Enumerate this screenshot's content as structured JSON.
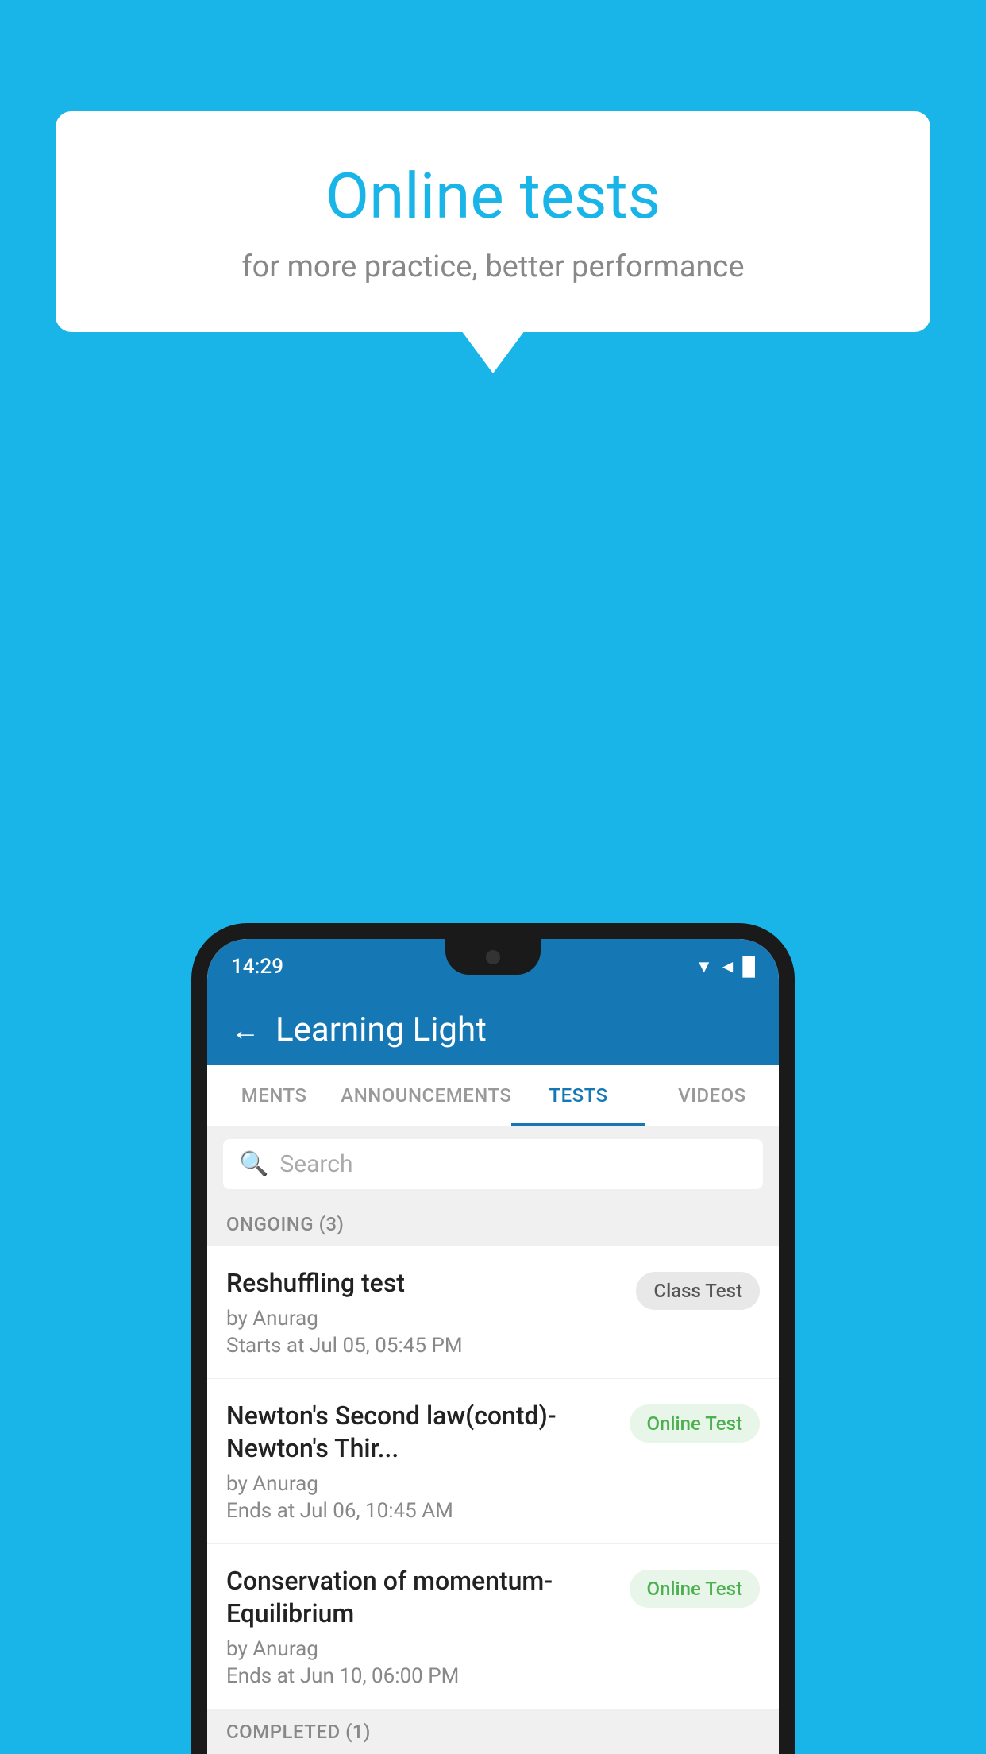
{
  "background": {
    "color": "#1ab5e8"
  },
  "speech_bubble": {
    "title": "Online tests",
    "subtitle": "for more practice, better performance"
  },
  "phone": {
    "status_bar": {
      "time": "14:29",
      "icons": "▼◄█"
    },
    "app_header": {
      "back_label": "←",
      "title": "Learning Light"
    },
    "tabs": [
      {
        "label": "MENTS",
        "active": false
      },
      {
        "label": "ANNOUNCEMENTS",
        "active": false
      },
      {
        "label": "TESTS",
        "active": true
      },
      {
        "label": "VIDEOS",
        "active": false
      }
    ],
    "search": {
      "placeholder": "Search",
      "icon": "🔍"
    },
    "section_ongoing": {
      "label": "ONGOING (3)"
    },
    "test_items": [
      {
        "name": "Reshuffling test",
        "by": "by Anurag",
        "date": "Starts at  Jul 05, 05:45 PM",
        "badge": "Class Test",
        "badge_type": "class"
      },
      {
        "name": "Newton's Second law(contd)-Newton's Thir...",
        "by": "by Anurag",
        "date": "Ends at  Jul 06, 10:45 AM",
        "badge": "Online Test",
        "badge_type": "online"
      },
      {
        "name": "Conservation of momentum-Equilibrium",
        "by": "by Anurag",
        "date": "Ends at  Jun 10, 06:00 PM",
        "badge": "Online Test",
        "badge_type": "online"
      }
    ],
    "section_completed": {
      "label": "COMPLETED (1)"
    }
  }
}
